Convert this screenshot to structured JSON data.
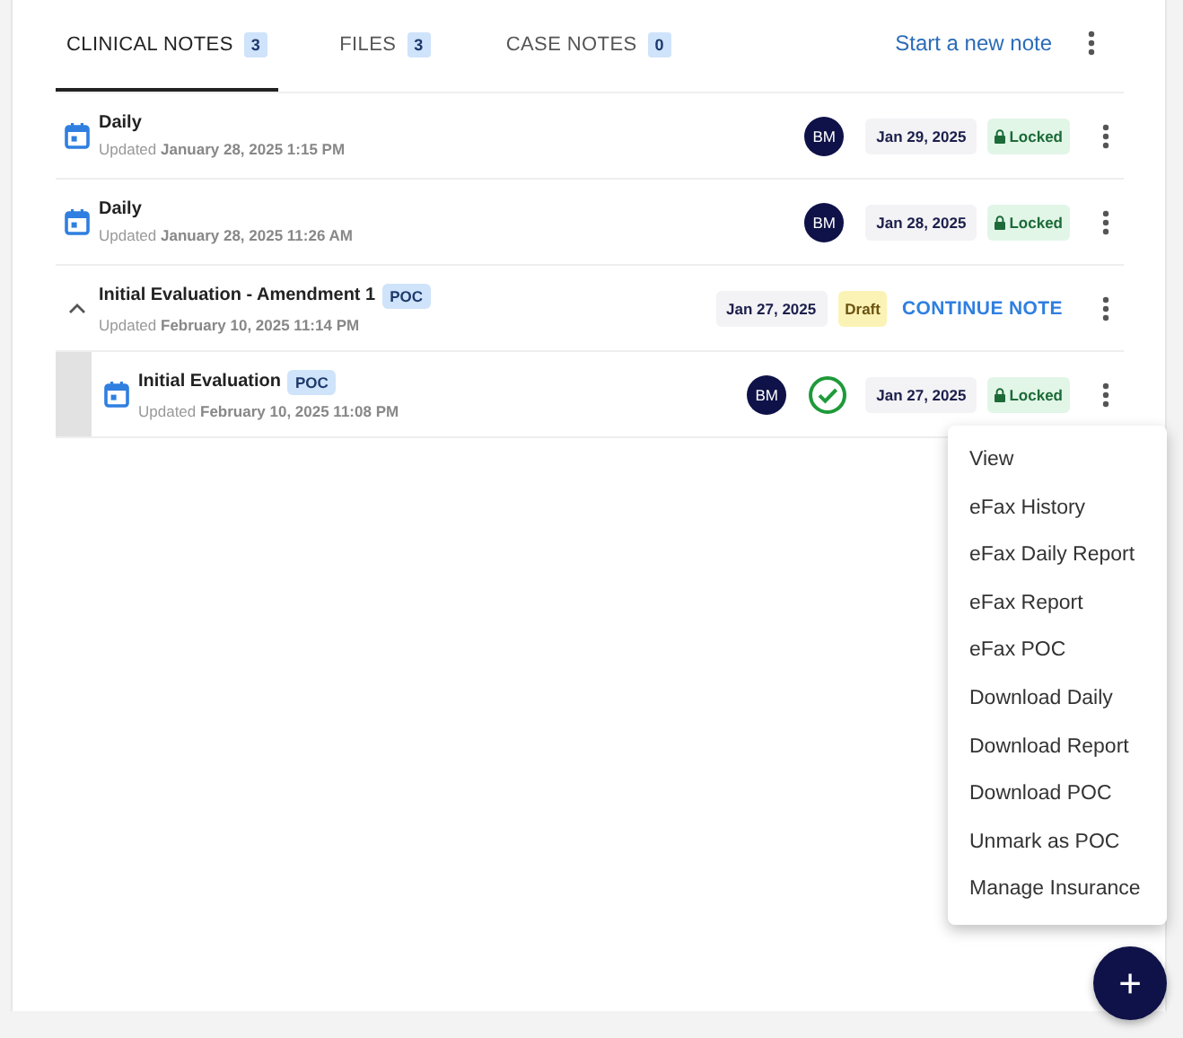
{
  "tabs": [
    {
      "label": "CLINICAL NOTES",
      "count": "3",
      "selected": true
    },
    {
      "label": "FILES",
      "count": "3",
      "selected": false
    },
    {
      "label": "CASE NOTES",
      "count": "0",
      "selected": false
    }
  ],
  "new_note_link": "Start a new note",
  "notes": [
    {
      "kind": "note",
      "title": "Daily",
      "updated_label": "Updated",
      "updated_date": "January 28, 2025 1:15 PM",
      "avatar": "BM",
      "date": "Jan 29, 2025",
      "status": {
        "kind": "locked",
        "label": "Locked"
      }
    },
    {
      "kind": "note",
      "title": "Daily",
      "updated_label": "Updated",
      "updated_date": "January 28, 2025 11:26 AM",
      "avatar": "BM",
      "date": "Jan 28, 2025",
      "status": {
        "kind": "locked",
        "label": "Locked"
      }
    },
    {
      "kind": "group",
      "title": "Initial Evaluation - Amendment 1",
      "badge": "POC",
      "expanded": true,
      "updated_label": "Updated",
      "updated_date": "February 10, 2025 11:14 PM",
      "date": "Jan 27, 2025",
      "status": {
        "kind": "draft",
        "label": "Draft"
      },
      "action": "CONTINUE NOTE",
      "children": [
        {
          "kind": "note",
          "title": "Initial Evaluation",
          "badge": "POC",
          "updated_label": "Updated",
          "updated_date": "February 10, 2025 11:08 PM",
          "avatar": "BM",
          "signed": true,
          "date": "Jan 27, 2025",
          "status": {
            "kind": "locked",
            "label": "Locked"
          }
        }
      ]
    }
  ],
  "menu": [
    "View",
    "eFax History",
    "eFax Daily Report",
    "eFax Report",
    "eFax POC",
    "Download Daily",
    "Download Report",
    "Download POC",
    "Unmark as POC",
    "Manage Insurance"
  ],
  "fab": "+"
}
